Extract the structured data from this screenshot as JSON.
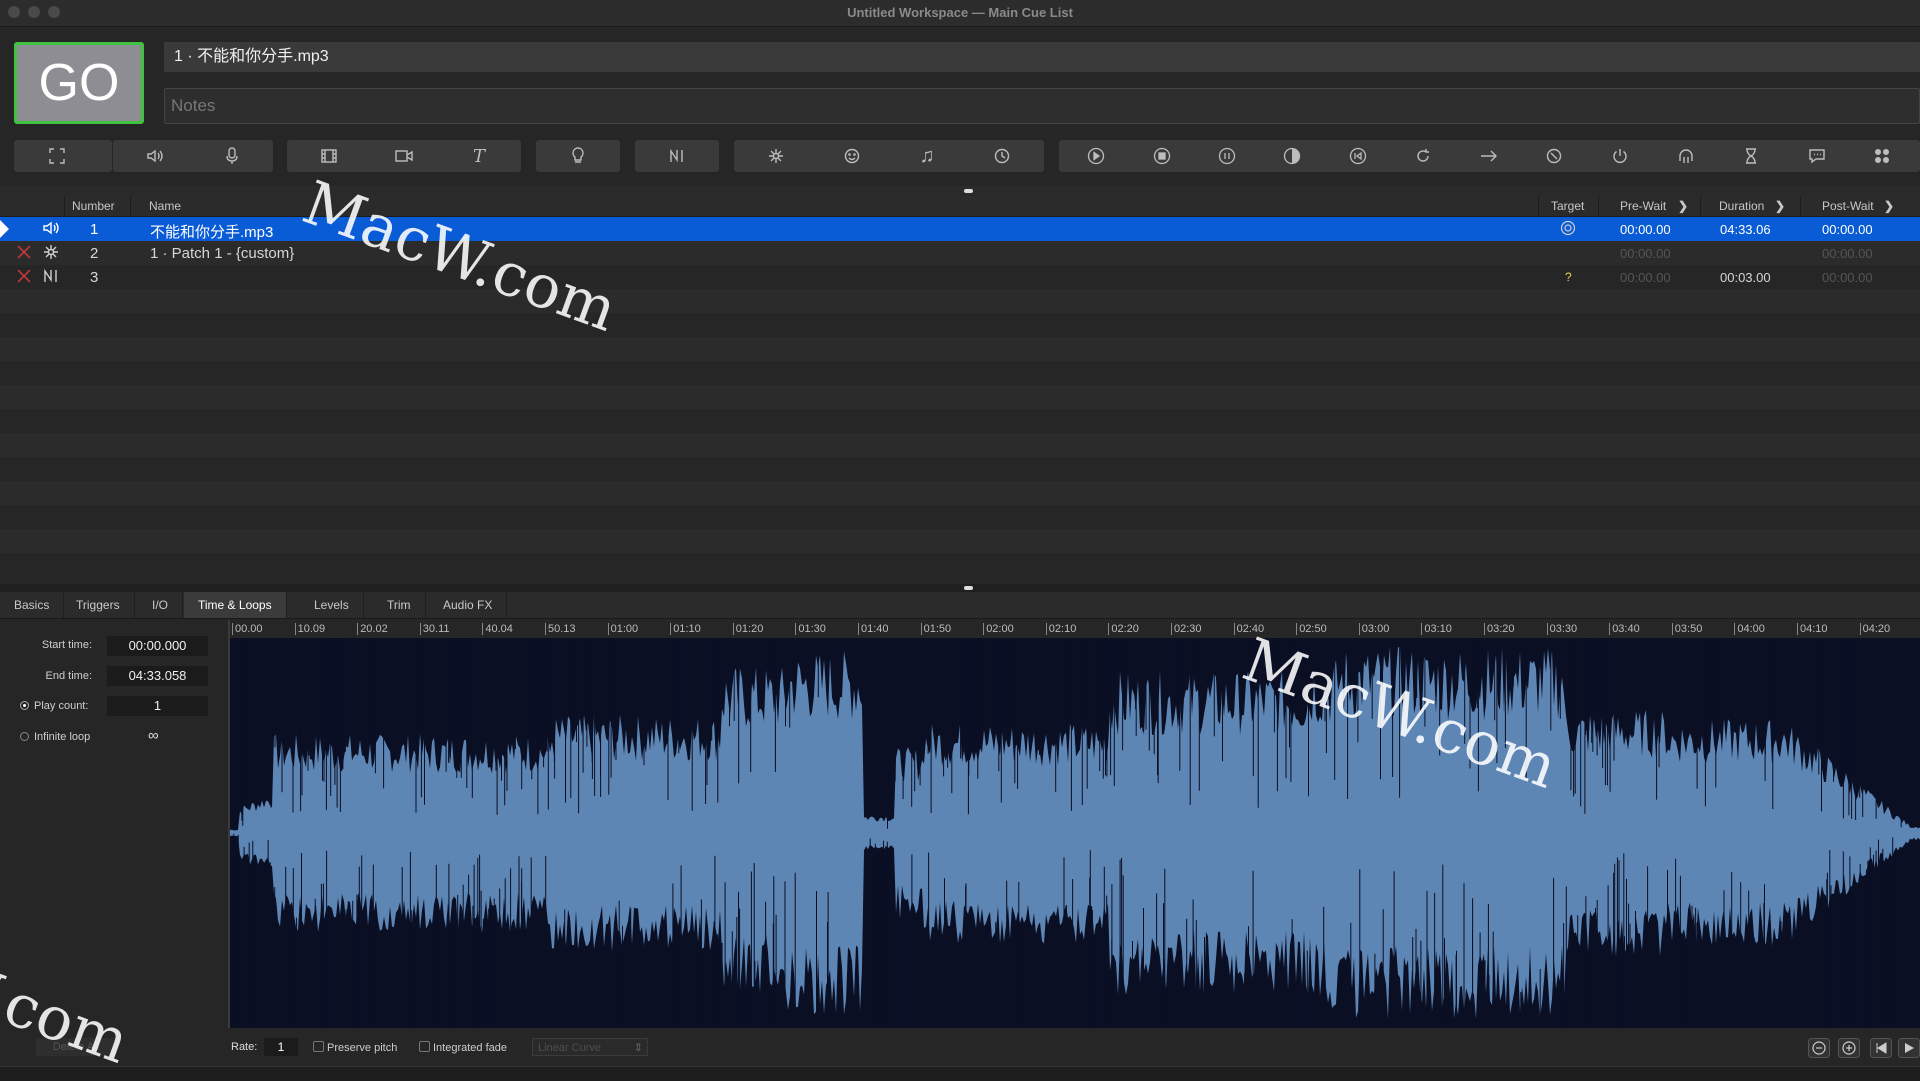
{
  "window": {
    "title": "Untitled Workspace — Main Cue List"
  },
  "go_button": {
    "label": "GO"
  },
  "standby": {
    "cue_name": "1 · 不能和你分手.mp3",
    "notes_placeholder": "Notes"
  },
  "toolbar": {
    "groups": [
      "workspace",
      "audio",
      "video",
      "light",
      "network",
      "control",
      "transport"
    ],
    "icons": [
      "fullscreen-icon",
      "speaker-icon",
      "microphone-icon",
      "film-icon",
      "camera-icon",
      "text-icon",
      "lightbulb-icon",
      "network-icon",
      "patch-icon",
      "face-icon",
      "music-note-icon",
      "clock-icon",
      "play-icon",
      "stop-icon",
      "pause-icon",
      "load-icon",
      "reset-icon",
      "refresh-icon",
      "goto-icon",
      "target-icon",
      "power-icon",
      "headphone-icon",
      "hourglass-icon",
      "chat-icon",
      "grid-icon"
    ]
  },
  "cue_table": {
    "headers": {
      "number": "Number",
      "name": "Name",
      "target": "Target",
      "prewait": "Pre-Wait",
      "duration": "Duration",
      "postwait": "Post-Wait"
    },
    "rows": [
      {
        "number": "1",
        "name": "不能和你分手.mp3",
        "target": "",
        "prewait": "00:00.00",
        "duration": "04:33.06",
        "postwait": "00:00.00",
        "selected": true,
        "type_icon": "speaker-icon"
      },
      {
        "number": "2",
        "name": "1 · Patch 1 - {custom}",
        "target": "",
        "prewait": "00:00.00",
        "duration": "",
        "postwait": "00:00.00",
        "selected": false,
        "type_icon": "patch-icon"
      },
      {
        "number": "3",
        "name": "",
        "target": "?",
        "prewait": "00:00.00",
        "duration": "00:03.00",
        "postwait": "00:00.00",
        "selected": false,
        "type_icon": "network-icon"
      }
    ]
  },
  "inspector": {
    "tabs": [
      "Basics",
      "Triggers",
      "I/O",
      "Time & Loops",
      "Levels",
      "Trim",
      "Audio FX"
    ],
    "active_tab": "Time & Loops",
    "start_time": {
      "label": "Start time:",
      "value": "00:00.000"
    },
    "end_time": {
      "label": "End time:",
      "value": "04:33.058"
    },
    "play_count": {
      "label": "Play count:",
      "value": "1"
    },
    "infinite_loop": {
      "label": "Infinite loop",
      "value": "∞"
    },
    "delete_all_label": "Delete All",
    "rate": {
      "label": "Rate:",
      "value": "1"
    },
    "preserve_pitch_label": "Preserve pitch",
    "integrated_fade_label": "Integrated fade",
    "curve_select": "Linear Curve",
    "ruler_ticks": [
      "00.00",
      "10.09",
      "20.02",
      "30.11",
      "40.04",
      "50.13",
      "01:00",
      "01:10",
      "01:20",
      "01:30",
      "01:40",
      "01:50",
      "02:00",
      "02:10",
      "02:20",
      "02:30",
      "02:40",
      "02:50",
      "03:00",
      "03:10",
      "03:20",
      "03:30",
      "03:40",
      "03:50",
      "04:00",
      "04:10",
      "04:20"
    ]
  },
  "watermark": {
    "text": "MacW.com"
  },
  "colors": {
    "selection": "#0a5bd6",
    "go_border": "#3fc23f",
    "waveform": "#5e86b5",
    "waveform_bg": "#0a0f24"
  }
}
